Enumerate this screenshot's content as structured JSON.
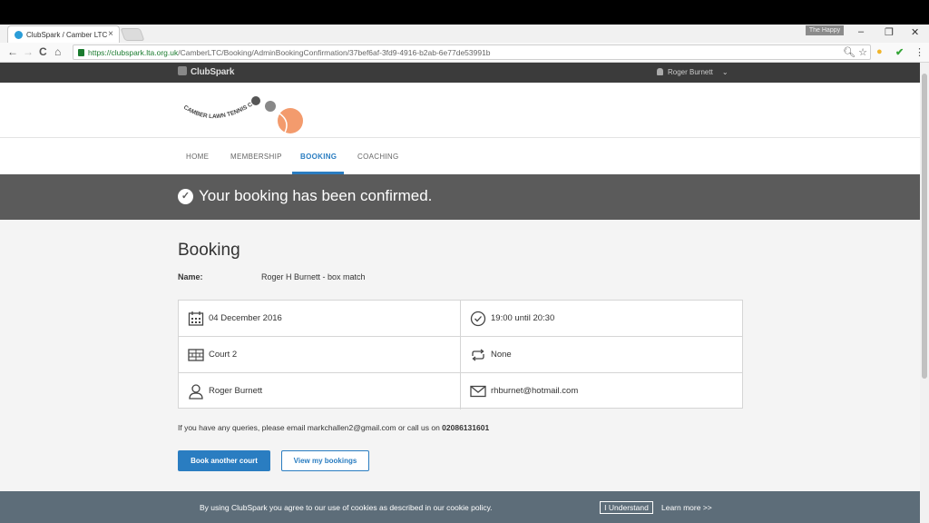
{
  "browser": {
    "tab_title": "ClubSpark / Camber LTC",
    "tab_close": "×",
    "profile_badge": "The Happy",
    "url_host": "https://clubspark.lta.org.uk",
    "url_path": "/CamberLTC/Booking/AdminBookingConfirmation/37bef6af-3fd9-4916-b2ab-6e77de53991b",
    "controls": {
      "minimize": "–",
      "restore": "❐",
      "close": "✕"
    },
    "nav": {
      "back": "←",
      "forward": "→",
      "reload": "C",
      "home": "⌂"
    }
  },
  "site": {
    "brand": "ClubSpark",
    "user_name": "Roger Burnett",
    "logo_text": "CAMBER LAWN TENNIS CLUB",
    "menu": [
      {
        "label": "HOME",
        "active": false
      },
      {
        "label": "MEMBERSHIP",
        "active": false
      },
      {
        "label": "BOOKING",
        "active": true
      },
      {
        "label": "COACHING",
        "active": false
      }
    ]
  },
  "banner": {
    "message": "Your booking has been confirmed.",
    "icon": "check-circle-icon"
  },
  "booking": {
    "heading": "Booking",
    "name_label": "Name:",
    "name_value": "Roger H Burnett - box match",
    "date": "04 December 2016",
    "time": "19:00 until 20:30",
    "court": "Court 2",
    "repeat": "None",
    "person": "Roger Burnett",
    "email": "rhburnet@hotmail.com",
    "queries_prefix": "If you have any queries, please email markchallen2@gmail.com or call us on ",
    "phone": "02086131601",
    "btn_book_another": "Book another court",
    "btn_view_bookings": "View my bookings"
  },
  "cookie": {
    "text": "By using ClubSpark you agree to our use of cookies as described in our cookie policy.",
    "accept": "I Understand",
    "learn": "Learn more >>"
  },
  "colors": {
    "accent": "#2a7dc1",
    "banner": "#5b5b5b",
    "topbar": "#3b3b3b",
    "cookie": "#5d6d79",
    "ball": "#f39b6d"
  }
}
